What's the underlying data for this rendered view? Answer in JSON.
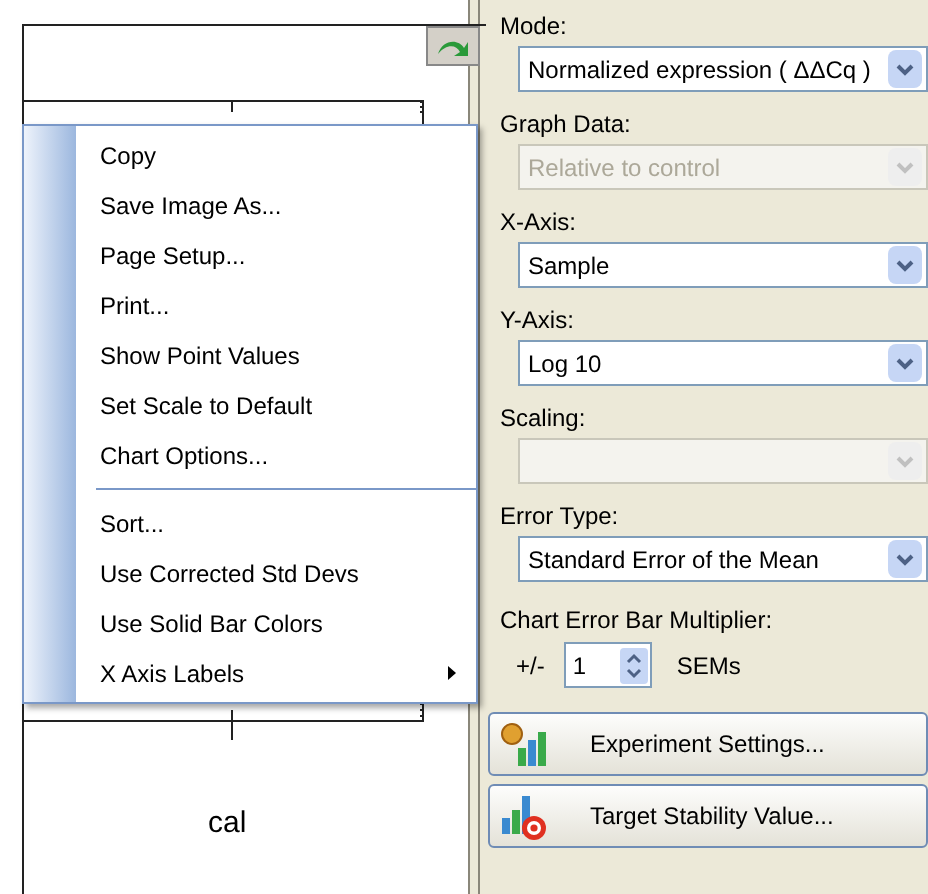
{
  "chart": {
    "x_label": "cal"
  },
  "context_menu": {
    "items": [
      {
        "kind": "item",
        "label": "Copy"
      },
      {
        "kind": "item",
        "label": "Save Image As..."
      },
      {
        "kind": "item",
        "label": "Page Setup..."
      },
      {
        "kind": "item",
        "label": "Print..."
      },
      {
        "kind": "item",
        "label": "Show Point Values"
      },
      {
        "kind": "item",
        "label": "Set Scale to Default"
      },
      {
        "kind": "item",
        "label": "Chart Options..."
      },
      {
        "kind": "separator"
      },
      {
        "kind": "item",
        "label": "Sort..."
      },
      {
        "kind": "item",
        "label": "Use Corrected Std Devs"
      },
      {
        "kind": "item",
        "label": "Use Solid Bar Colors"
      },
      {
        "kind": "submenu",
        "label": "X Axis Labels"
      }
    ]
  },
  "settings": {
    "fields": [
      {
        "label": "Mode:",
        "value": "Normalized expression ( ΔΔCq )",
        "disabled": false
      },
      {
        "label": "Graph Data:",
        "value": "Relative to control",
        "disabled": true
      },
      {
        "label": "X-Axis:",
        "value": "Sample",
        "disabled": false
      },
      {
        "label": "Y-Axis:",
        "value": "Log 10",
        "disabled": false
      },
      {
        "label": "Scaling:",
        "disabled": true
      },
      {
        "label": "Error Type:",
        "value": "Standard Error of the Mean",
        "disabled": false
      }
    ],
    "multiplier": {
      "label": "Chart Error Bar Multiplier:",
      "prefix": "+/-",
      "value": "1",
      "unit": "SEMs"
    },
    "buttons": [
      {
        "kind": "experiment",
        "label": "Experiment Settings..."
      },
      {
        "kind": "stability",
        "label": "Target Stability Value..."
      }
    ]
  }
}
